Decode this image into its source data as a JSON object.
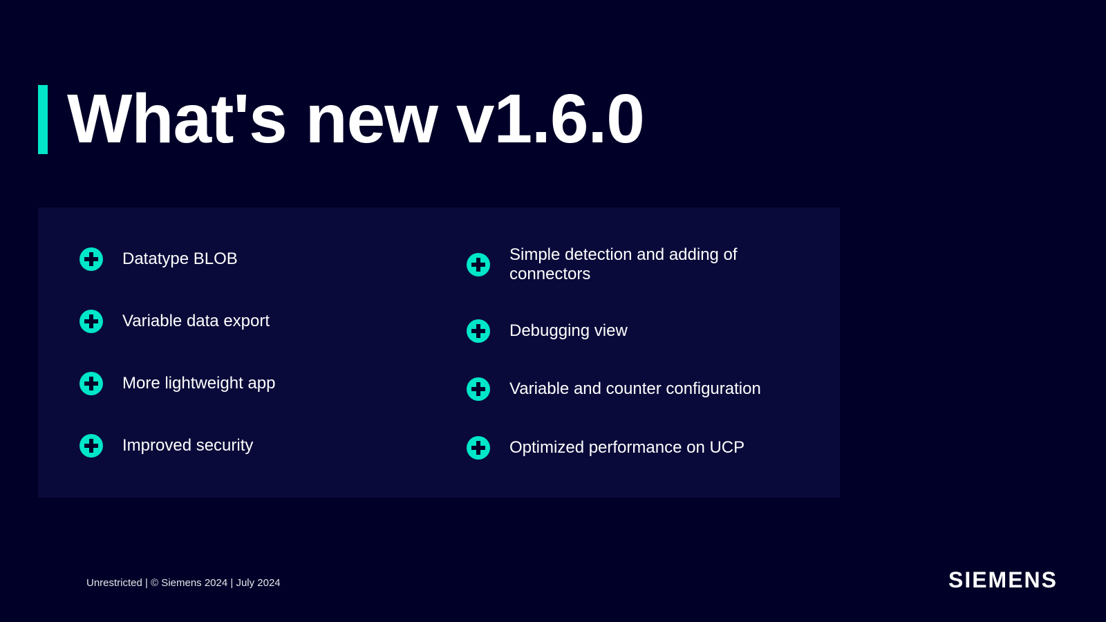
{
  "title": "What's new v1.6.0",
  "features": {
    "left": [
      "Datatype BLOB",
      "Variable data export",
      "More lightweight app",
      "Improved security"
    ],
    "right": [
      "Simple detection and adding of connectors",
      "Debugging view",
      "Variable and counter configuration",
      "Optimized performance on UCP"
    ]
  },
  "footer": "Unrestricted | © Siemens 2024 | July 2024",
  "logo": "SIEMENS"
}
